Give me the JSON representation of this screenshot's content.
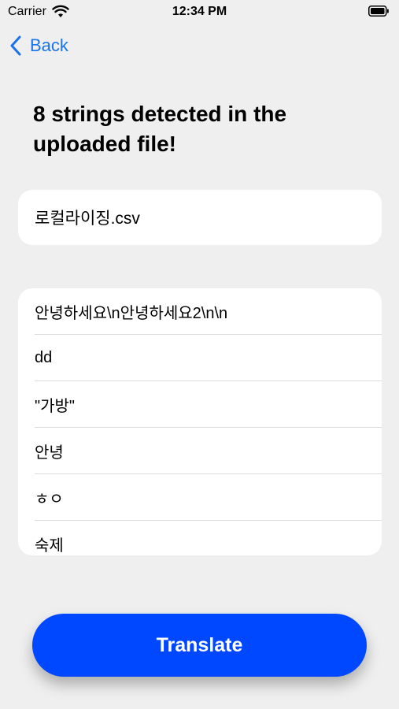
{
  "status_bar": {
    "carrier": "Carrier",
    "time": "12:34 PM",
    "wifi_icon": "wifi-icon",
    "battery_icon": "battery-icon"
  },
  "nav": {
    "back_label": "Back",
    "back_icon": "chevron-left-icon",
    "accent_color": "#1a73e8"
  },
  "header": {
    "title": "8 strings detected in the uploaded file!"
  },
  "file": {
    "name": "로컬라이징.csv"
  },
  "strings": [
    "안녕하세요\\n안녕하세요2\\n\\n",
    "dd",
    "\"가방\"",
    "안녕",
    "ㅎㅇ",
    "숙제"
  ],
  "actions": {
    "translate_label": "Translate",
    "button_color": "#0048ff"
  }
}
